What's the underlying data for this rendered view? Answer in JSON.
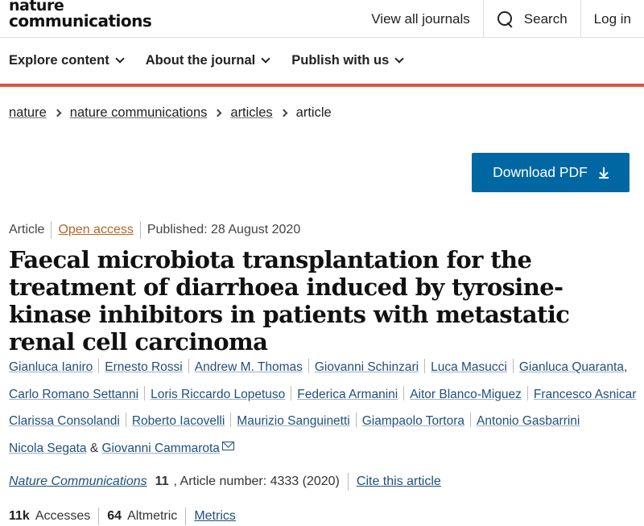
{
  "header": {
    "logo_line1": "nature",
    "logo_line2": "communications",
    "view_journals": "View all journals",
    "search": "Search",
    "login": "Log in"
  },
  "subnav": {
    "items": [
      "Explore content",
      "About the journal",
      "Publish with us"
    ]
  },
  "breadcrumb": [
    "nature",
    "nature communications",
    "articles",
    "article"
  ],
  "download_pdf": "Download PDF",
  "meta": {
    "type": "Article",
    "access": "Open access",
    "published": "Published: 28 August 2020"
  },
  "title": "Faecal microbiota transplantation for the treatment of diarrhoea induced by tyrosine-kinase inhibitors in patients with metastatic renal cell carcinoma",
  "authors": [
    "Gianluca Ianiro",
    "Ernesto Rossi",
    "Andrew M. Thomas",
    "Giovanni Schinzari",
    "Luca Masucci",
    "Gianluca Quaranta",
    "Carlo Romano Settanni",
    "Loris Riccardo Lopetuso",
    "Federica Armanini",
    "Aitor Blanco-Miguez",
    "Francesco Asnicar",
    "Clarissa Consolandi",
    "Roberto Iacovelli",
    "Maurizio Sanguinetti",
    "Giampaolo Tortora",
    "Antonio Gasbarrini",
    "Nicola Segata",
    "Giovanni Cammarota"
  ],
  "authors_amp": "&",
  "citation": {
    "journal": "Nature Communications",
    "volume": "11",
    "article_number": ", Article number: 4333 (2020)",
    "cite_link": "Cite this article"
  },
  "stats": {
    "accesses_value": "11k",
    "accesses_label": "Accesses",
    "altmetric_value": "64",
    "altmetric_label": "Altmetric",
    "metrics_link": "Metrics"
  },
  "colors": {
    "accent_red": "#e0533f",
    "button_blue": "#0067a3",
    "link_blue": "#1f4f7d",
    "open_access_orange": "#b8642a"
  }
}
